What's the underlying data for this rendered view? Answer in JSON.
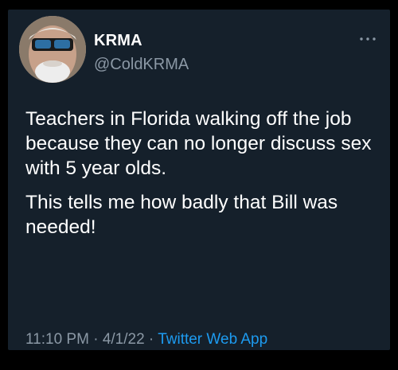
{
  "tweet": {
    "author": {
      "display_name": "KRMA",
      "handle": "@ColdKRMA",
      "avatar_icon": "profile-photo-man-with-sunglasses"
    },
    "more_icon": "more-options-icon",
    "paragraphs": [
      "Teachers in Florida walking off the job because they can no longer discuss sex with 5 year olds.",
      "This tells me how badly that Bill was needed!"
    ],
    "time": "11:10 PM",
    "separator": "·",
    "date": "4/1/22",
    "source": "Twitter Web App"
  },
  "colors": {
    "card_background": "#15202b",
    "primary_text": "#ffffff",
    "secondary_text": "#8b98a5",
    "link": "#1d9bf0"
  }
}
